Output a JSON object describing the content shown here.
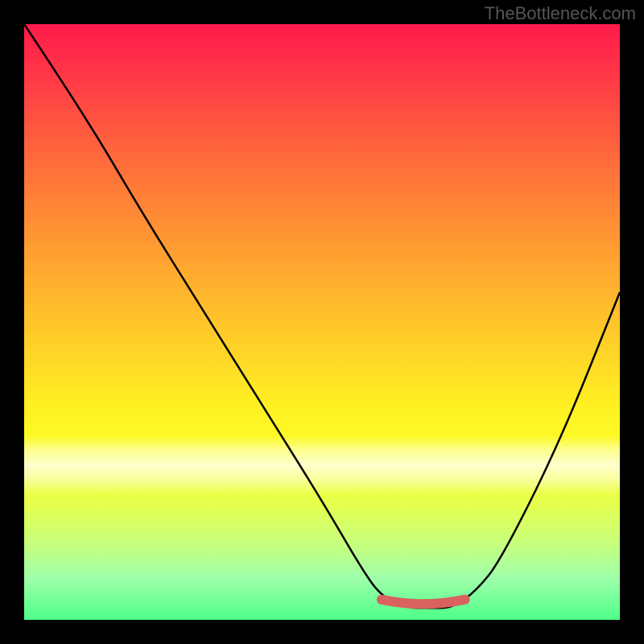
{
  "watermark": "TheBottleneck.com",
  "chart_data": {
    "type": "line",
    "title": "",
    "xlabel": "",
    "ylabel": "",
    "xlim": [
      0,
      100
    ],
    "ylim": [
      0,
      100
    ],
    "series": [
      {
        "name": "bottleneck-curve",
        "x": [
          0,
          10,
          20,
          30,
          40,
          50,
          57,
          60,
          64,
          68,
          72,
          76,
          80,
          90,
          100
        ],
        "y": [
          100,
          85,
          68,
          52,
          36,
          20,
          8,
          4,
          2,
          2,
          2,
          5,
          10,
          30,
          55
        ]
      }
    ],
    "markers": [
      {
        "name": "optimal-range",
        "x_start": 60,
        "x_end": 74,
        "y": 3,
        "color": "#d9625f"
      }
    ],
    "gradient_stops": [
      {
        "pos": 0,
        "color": "#ff1a4a"
      },
      {
        "pos": 50,
        "color": "#ffd128"
      },
      {
        "pos": 100,
        "color": "#4dff88"
      }
    ]
  }
}
